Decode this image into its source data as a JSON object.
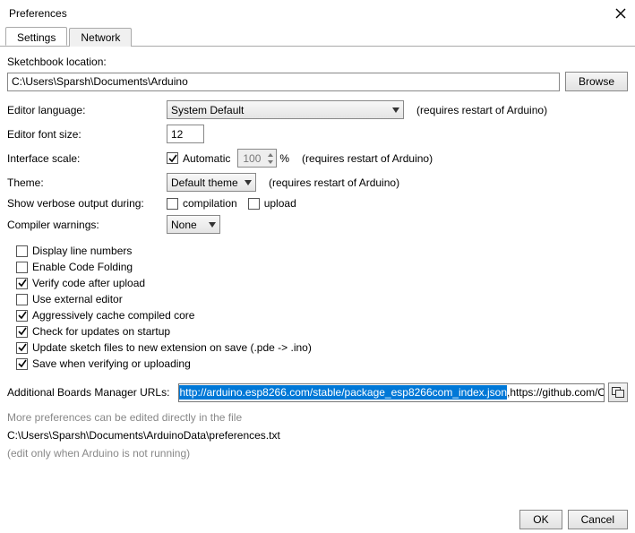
{
  "window": {
    "title": "Preferences"
  },
  "tabs": {
    "settings": "Settings",
    "network": "Network"
  },
  "sketchbook": {
    "label": "Sketchbook location:",
    "path": "C:\\Users\\Sparsh\\Documents\\Arduino",
    "browse": "Browse"
  },
  "language": {
    "label": "Editor language:",
    "value": "System Default",
    "note": "(requires restart of Arduino)"
  },
  "fontsize": {
    "label": "Editor font size:",
    "value": "12"
  },
  "scale": {
    "label": "Interface scale:",
    "auto": "Automatic",
    "value": "100",
    "pct": "%",
    "note": "(requires restart of Arduino)"
  },
  "theme": {
    "label": "Theme:",
    "value": "Default theme",
    "note": "(requires restart of Arduino)"
  },
  "verbose": {
    "label": "Show verbose output during:",
    "compile": "compilation",
    "upload": "upload"
  },
  "warnings": {
    "label": "Compiler warnings:",
    "value": "None"
  },
  "options": {
    "lineNumbers": "Display line numbers",
    "codeFolding": "Enable Code Folding",
    "verifyUpload": "Verify code after upload",
    "externalEditor": "Use external editor",
    "cacheCore": "Aggressively cache compiled core",
    "checkUpdates": "Check for updates on startup",
    "updateExt": "Update sketch files to new extension on save (.pde -> .ino)",
    "saveVerify": "Save when verifying or uploading"
  },
  "boards": {
    "label": "Additional Boards Manager URLs:",
    "selected": "http://arduino.esp8266.com/stable/package_esp8266com_index.json",
    "rest": ",https://github.com/Optiboot/opt"
  },
  "moreprefs": {
    "line1": "More preferences can be edited directly in the file",
    "path": "C:\\Users\\Sparsh\\Documents\\ArduinoData\\preferences.txt",
    "line2": "(edit only when Arduino is not running)"
  },
  "buttons": {
    "ok": "OK",
    "cancel": "Cancel"
  }
}
